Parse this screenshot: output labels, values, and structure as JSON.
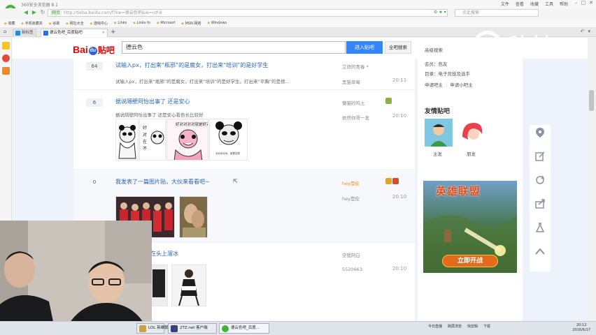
{
  "browser": {
    "title": "360安全浏览器 8.1",
    "menus": [
      "文件",
      "查看",
      "收藏",
      "工具",
      "帮助"
    ],
    "url": "http://tieba.baidu.com/f?kw=德云色吧&ie=utf-8",
    "url_tag": "网页",
    "search_placeholder": "点此搜索",
    "bookmarks": [
      "收藏",
      "手机收藏夹",
      "谷歌",
      "网址大全",
      "游戏中心",
      "Links",
      "Links fo",
      "Microsof",
      "MSN 网络",
      "Windows"
    ],
    "tabs": [
      {
        "label": "新标签页"
      },
      {
        "label": "德云色吧_百度贴吧"
      }
    ]
  },
  "tieba": {
    "logo": {
      "part1": "Bai",
      "paw": "du",
      "part2": "贴吧"
    },
    "search_value": "德云色",
    "enter_button": "进入贴吧",
    "all_search_button": "全吧搜索",
    "advanced_search": "高级搜索"
  },
  "threads": [
    {
      "reply_count": "64",
      "title": "试输入px，打出来“瓶邪”的是腐女，打出来“培训”的是好学生",
      "abstract": "试输入px，打出来“瓶邪”的是腐女，打出来“培训”的是好学生。打出来“平胸”的是德...",
      "author": "艾德的青春 *",
      "last_replier": "黑猫草莓",
      "time": "20:11"
    },
    {
      "reply_count": "6",
      "title": "据说隔壁阿怡出事了 还是安心",
      "abstract": "据说隔壁阿怡出事了 还是安心看色长比较好",
      "author": "懒猫的鸡土",
      "last_replier": "依然你哥一发",
      "time": "20:10",
      "meme_texts": [
        "好对对对对就是好对",
        "对对对对对，就是这样"
      ]
    },
    {
      "reply_count": "0",
      "title": "我发表了一篇图片贴，大伙来看看吧~",
      "author": "hey是伦",
      "last_replier": "hey是伦",
      "time": "20:10"
    },
    {
      "title": "在头上溜冰",
      "author": "空我阿白",
      "last_replier": "5520663",
      "time": "20:10"
    }
  ],
  "sidebar": {
    "member_label": "会员：色友",
    "directory_label": "目录：电子竞技及选手",
    "apply_owner": "申请吧主",
    "apply_sub_owner": "申请小吧主",
    "friends_title": "友情贴吧",
    "friends": [
      {
        "name": "主发"
      },
      {
        "name": "朋发"
      }
    ],
    "ad": {
      "title": "英雄联盟",
      "button": "立即开战"
    }
  },
  "float_toolbar_icons": [
    "location-icon",
    "edit-icon",
    "refresh-icon",
    "share-icon",
    "flask-icon",
    "chevron-up-icon"
  ],
  "watermark": {
    "text": "秒拍"
  },
  "taskbar": {
    "items": [
      {
        "label": "LOL 英雄联盟"
      },
      {
        "label": "2TZ.net 客户端"
      },
      {
        "label": "德云色吧_百度..."
      }
    ],
    "tray": [
      "今日直播",
      "跨屏浏览",
      "快剪辑",
      "下载"
    ],
    "time": "20:12",
    "date": "2016/6/17"
  }
}
